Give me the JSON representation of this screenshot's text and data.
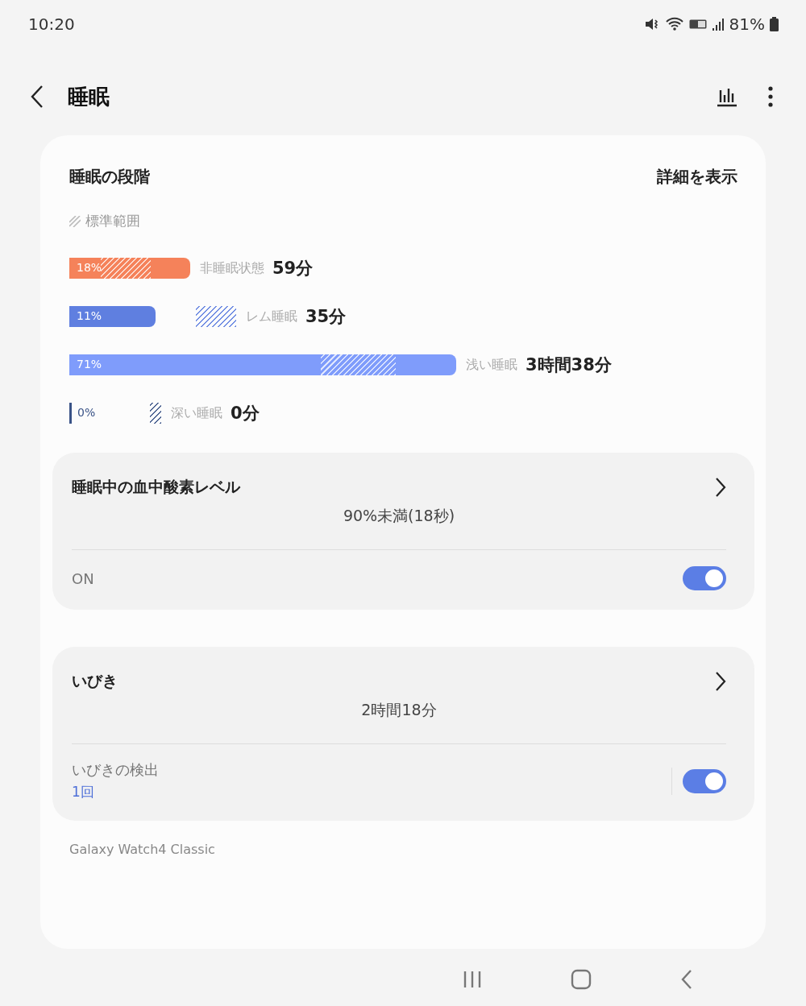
{
  "status_bar": {
    "time": "10:20",
    "battery": "81%"
  },
  "header": {
    "title": "睡眠"
  },
  "stages_card": {
    "title": "睡眠の段階",
    "details_link": "詳細を表示",
    "legend": "標準範囲",
    "stages": [
      {
        "kind": "awake",
        "percent": "18%",
        "label": "非睡眠状態",
        "value": "59分",
        "color": "#f5825a"
      },
      {
        "kind": "rem",
        "percent": "11%",
        "label": "レム睡眠",
        "value": "35分",
        "color": "#5f7fe0"
      },
      {
        "kind": "light",
        "percent": "71%",
        "label": "浅い睡眠",
        "value": "3時間38分",
        "color": "#7f9cfb"
      },
      {
        "kind": "deep",
        "percent": "0%",
        "label": "深い睡眠",
        "value": "0分",
        "color": "#3a5387"
      }
    ]
  },
  "oxygen_card": {
    "title": "睡眠中の血中酸素レベル",
    "summary": "90%未満(18秒)",
    "toggle": {
      "label": "ON",
      "on": true
    }
  },
  "snore_card": {
    "title": "いびき",
    "summary": "2時間18分",
    "toggle": {
      "label": "いびきの検出",
      "sub": "1回",
      "on": true
    }
  },
  "device": "Galaxy Watch4 Classic"
}
